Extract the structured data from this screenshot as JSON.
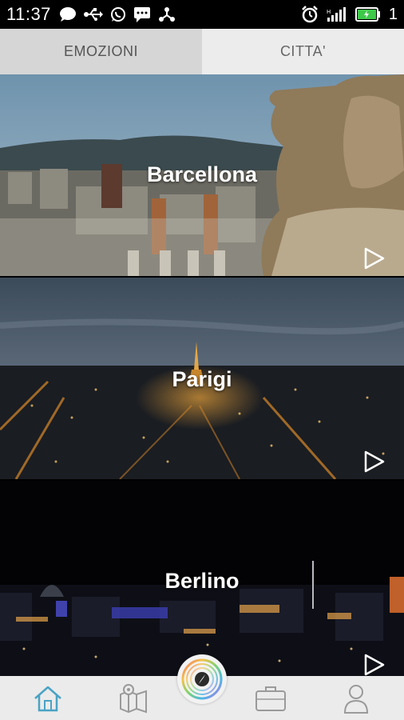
{
  "status_bar": {
    "time": "11:37",
    "notification_count": "1",
    "left_icons": [
      "chat-bubble-icon",
      "usb-icon",
      "whatsapp-icon",
      "sms-icon",
      "share-icon"
    ],
    "right_icons": [
      "alarm-icon",
      "signal-icon",
      "battery-icon"
    ]
  },
  "tabs": [
    {
      "label": "EMOZIONI",
      "selected": false
    },
    {
      "label": "CITTA'",
      "selected": true
    }
  ],
  "cities": [
    {
      "name": "Barcellona",
      "play_icon": "play-icon"
    },
    {
      "name": "Parigi",
      "play_icon": "play-icon"
    },
    {
      "name": "Berlino",
      "play_icon": "play-icon"
    }
  ],
  "bottom_nav": {
    "items": [
      "home-icon",
      "map-icon",
      "compass-icon",
      "suitcase-icon",
      "user-icon"
    ],
    "active": "home-icon",
    "accent_color": "#4aa3c4"
  }
}
